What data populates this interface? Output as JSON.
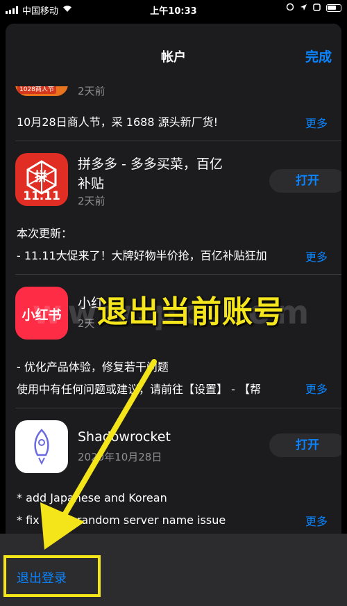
{
  "status_bar": {
    "carrier": "中国移动",
    "time": "上午10:33"
  },
  "nav": {
    "title": "帐户",
    "done_label": "完成"
  },
  "apps": [
    {
      "name": "",
      "date": "2天前",
      "note_lines": [
        "10月28日商人节，采 1688 源头新厂货!"
      ],
      "more_label": "更多",
      "icon_text": "1028商人节"
    },
    {
      "name": "拼多多 - 多多买菜，百亿补贴",
      "name_line1": "拼多多 - 多多买菜，百亿",
      "name_line2": "补贴",
      "date": "2天前",
      "open_label": "打开",
      "icon_text": "11.11",
      "icon_mid": "拼",
      "note_lines": [
        "本次更新：",
        "- 11.11大促来了！大牌好物半价抢，百亿补贴狂加"
      ],
      "more_label": "更多"
    },
    {
      "name": "小红书",
      "date": "2天前",
      "icon_text": "小红书",
      "name_visible": "小红",
      "date_visible": "2天",
      "note_lines": [
        "- 优化产品体验，修复若干问题",
        "使用中有任何问题或建议，请前往【设置】 - 【帮"
      ],
      "more_label": "更多"
    },
    {
      "name": "Shadowrocket",
      "date": "2020年10月28日",
      "open_label": "打开",
      "note_lines": [
        "* add Japanese and Korean",
        "* fix client random server name issue"
      ],
      "more_label": "更多"
    }
  ],
  "sign_out_label": "退出登录",
  "overlay_caption": "退出当前账号",
  "watermark": "www.pc.com",
  "colors": {
    "accent": "#0a84ff",
    "highlight": "#f4e41a",
    "sheet": "#1c1c1e"
  }
}
